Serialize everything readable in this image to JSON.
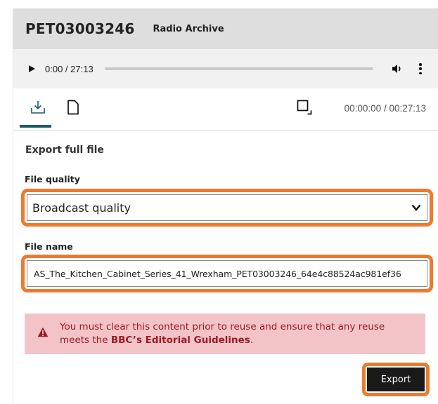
{
  "header": {
    "title": "PET03003246",
    "subtitle": "Radio Archive"
  },
  "player": {
    "time": "0:00 / 27:13",
    "progress": 0
  },
  "toolbar": {
    "tabs": [
      {
        "icon": "download-icon",
        "active": true
      },
      {
        "icon": "file-icon",
        "active": false
      }
    ],
    "range": "00:00:00 / 00:27:13",
    "crop_icon": "crop-icon"
  },
  "export_panel": {
    "title": "Export full file",
    "quality_label": "File quality",
    "quality_value": "Broadcast quality",
    "name_label": "File name",
    "name_value": "AS_The_Kitchen_Cabinet_Series_41_Wrexham_PET03003246_64e4c88524ac981ef36"
  },
  "warning": {
    "text_before": "You must clear this content prior to reuse and ensure that any reuse meets the ",
    "text_link": "BBC’s Editorial Guidelines",
    "text_after": "."
  },
  "export_button": "Export",
  "colors": {
    "highlight": "#ec7a2f",
    "warning_bg": "#f2c4c7",
    "warning_text": "#9e1a22",
    "tab_active": "#1b5a6b",
    "header_bg": "#dedede",
    "button_bg": "#1a1a1a"
  }
}
